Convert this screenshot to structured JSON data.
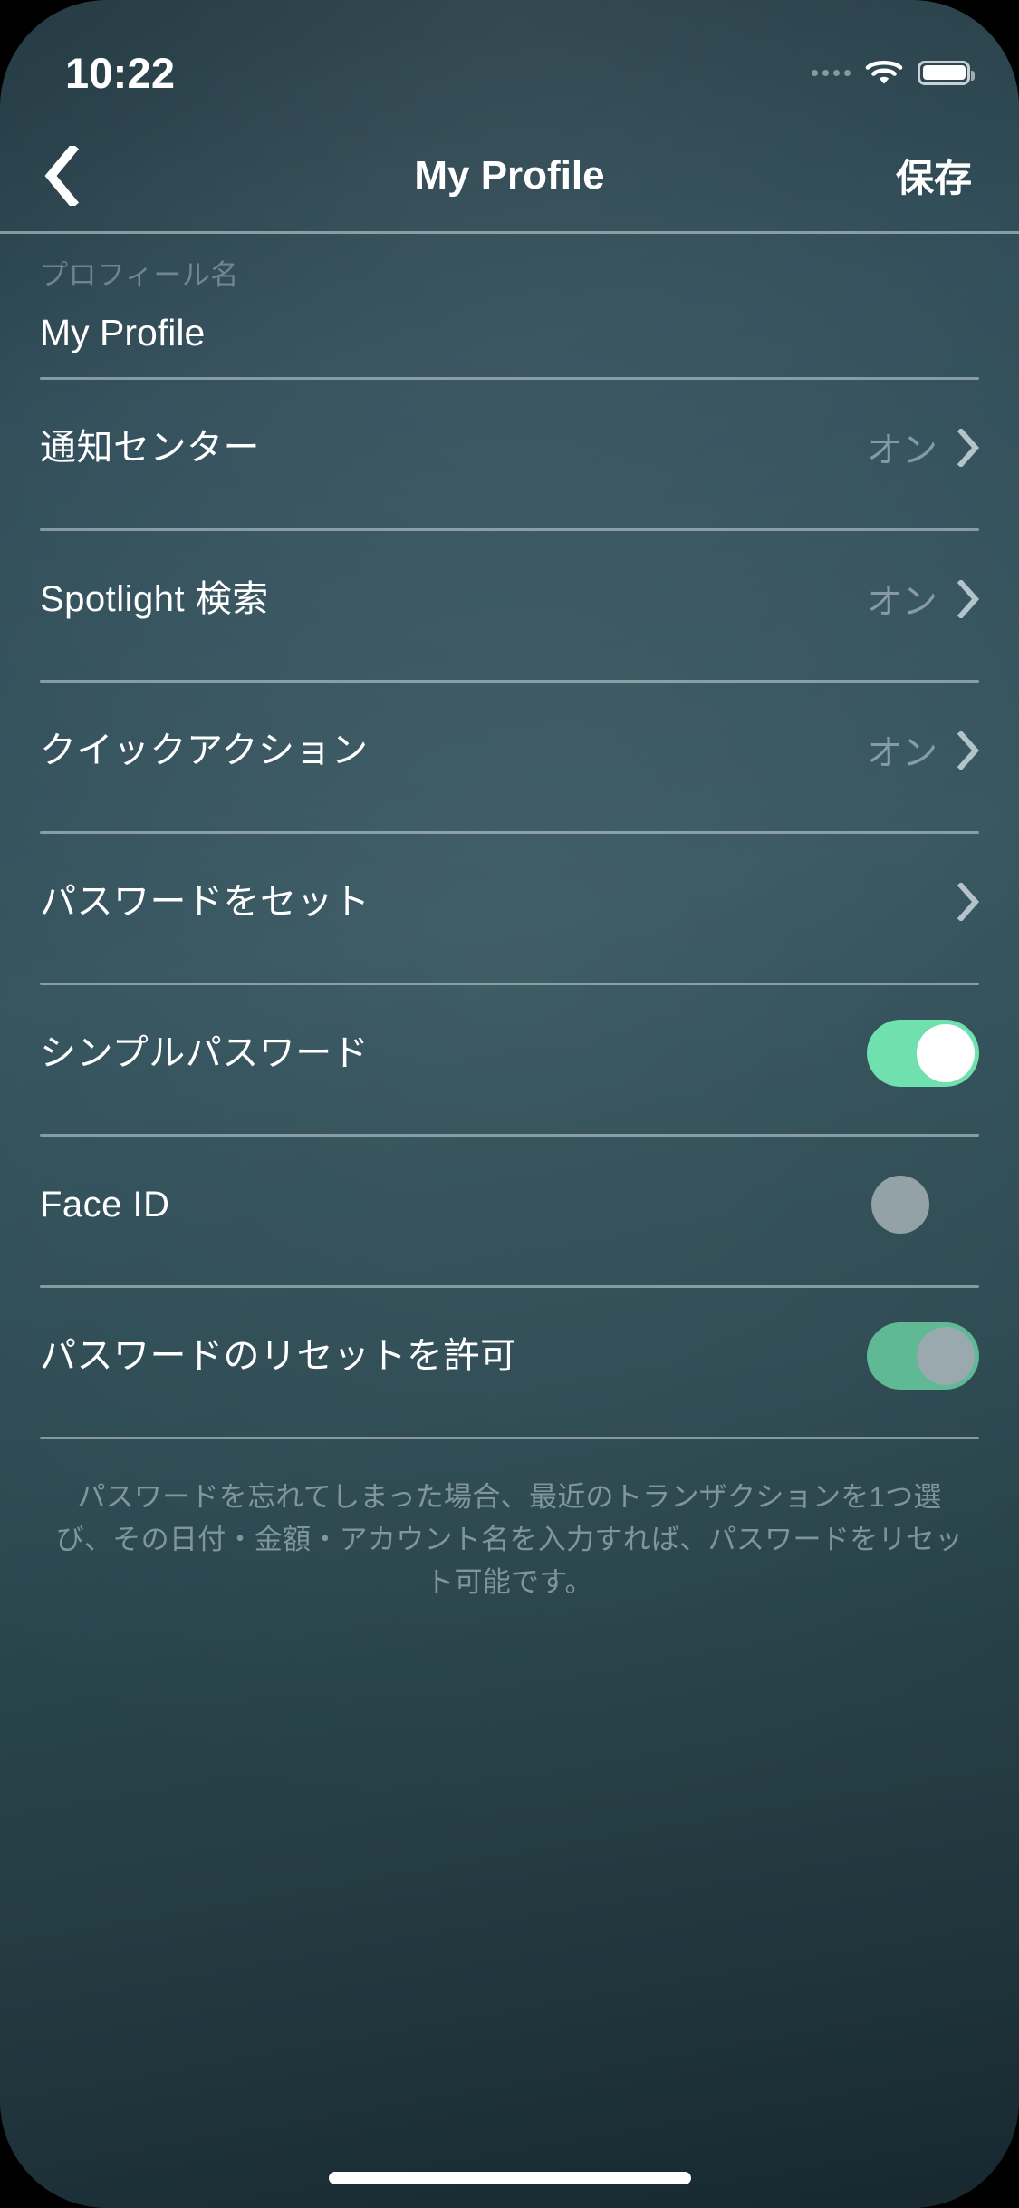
{
  "status_bar": {
    "time": "10:22",
    "signal_icon": "signal-dots-icon",
    "wifi_icon": "wifi-icon",
    "battery_icon": "battery-icon"
  },
  "nav_bar": {
    "back_icon": "chevron-left-icon",
    "title": "My Profile",
    "save_label": "保存"
  },
  "profile_field": {
    "label": "プロフィール名",
    "value": "My Profile"
  },
  "rows": [
    {
      "label": "通知センター",
      "value": "オン",
      "accessory": "chevron"
    },
    {
      "label": "Spotlight 検索",
      "value": "オン",
      "accessory": "chevron"
    },
    {
      "label": "クイックアクション",
      "value": "オン",
      "accessory": "chevron"
    },
    {
      "label": "パスワードをセット",
      "value": "",
      "accessory": "chevron"
    },
    {
      "label": "シンプルパスワード",
      "value": "",
      "accessory": "switch",
      "switch_state": "on"
    },
    {
      "label": "Face ID",
      "value": "",
      "accessory": "switch",
      "switch_state": "off"
    },
    {
      "label": "パスワードのリセットを許可",
      "value": "",
      "accessory": "switch",
      "switch_state": "on-disabled"
    }
  ],
  "footer": {
    "text": "パスワードを忘れてしまった場合、最近のトランザクションを1つ選び、その日付・金額・アカウント名を入力すれば、パスワードをリセット可能です。"
  },
  "home_indicator": {
    "name": "home-indicator"
  },
  "colors": {
    "switch_on_track": "#6fe0ae",
    "switch_on_knob": "#ffffff",
    "switch_off_knob": "#93a2a6",
    "switch_disabled_track": "#5fb995",
    "switch_disabled_knob": "#9aa9ad",
    "separator": "#bdcdd4",
    "text_primary": "#ffffff",
    "text_secondary": "#c6d4da",
    "bg_top": "#2a4854",
    "bg_bottom": "#17282f"
  }
}
